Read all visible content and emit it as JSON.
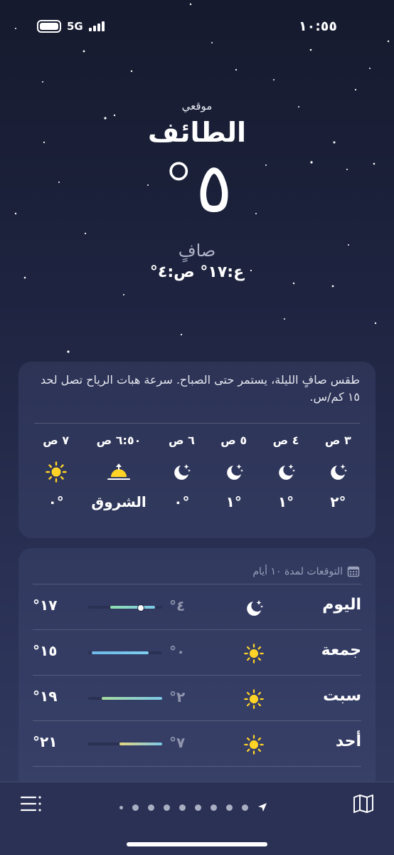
{
  "status_bar": {
    "network": "5G",
    "time": "١٠:٥٥"
  },
  "header": {
    "location_label": "موقعي",
    "city": "الطائف",
    "temperature": "°٥",
    "condition": "صافٍ",
    "hi_lo": "ع:١٧° ص:٤°"
  },
  "hourly": {
    "summary": "طقس صافٍ الليلة، يستمر حتى الصباح. سرعة هبات الرياح تصل لحد ١٥ كم/س.",
    "items": [
      {
        "time": "٣ ص",
        "icon": "moon-stars-icon",
        "value": "°٢"
      },
      {
        "time": "٤ ص",
        "icon": "moon-stars-icon",
        "value": "°١"
      },
      {
        "time": "٥ ص",
        "icon": "moon-stars-icon",
        "value": "°١"
      },
      {
        "time": "٦ ص",
        "icon": "moon-stars-icon",
        "value": "°٠"
      },
      {
        "time": "٦:٥٠ ص",
        "icon": "sunrise-icon",
        "value": "الشروق"
      },
      {
        "time": "٧ ص",
        "icon": "sun-icon",
        "value": "°٠"
      }
    ]
  },
  "forecast": {
    "title": "التوقعات لمدة ١٠ أيام",
    "days": [
      {
        "day": "اليوم",
        "icon": "moon-stars-icon",
        "low": "°٤",
        "high": "°١٧",
        "range_start": 0.3,
        "range_end": 0.9,
        "current": 0.7
      },
      {
        "day": "جمعة",
        "icon": "sun-icon",
        "low": "°٠",
        "high": "°١٥",
        "range_start": 0.05,
        "range_end": 0.82
      },
      {
        "day": "سبت",
        "icon": "sun-icon",
        "low": "°٢",
        "high": "°١٩",
        "range_start": 0.18,
        "range_end": 1.0
      },
      {
        "day": "أحد",
        "icon": "sun-icon",
        "low": "°٧",
        "high": "°٢١",
        "range_start": 0.42,
        "range_end": 1.0
      }
    ]
  },
  "colors": {
    "moon": "#ffffff",
    "sun": "#ffd426"
  },
  "tab_bar": {
    "page_count": 9,
    "active_page": 0
  }
}
